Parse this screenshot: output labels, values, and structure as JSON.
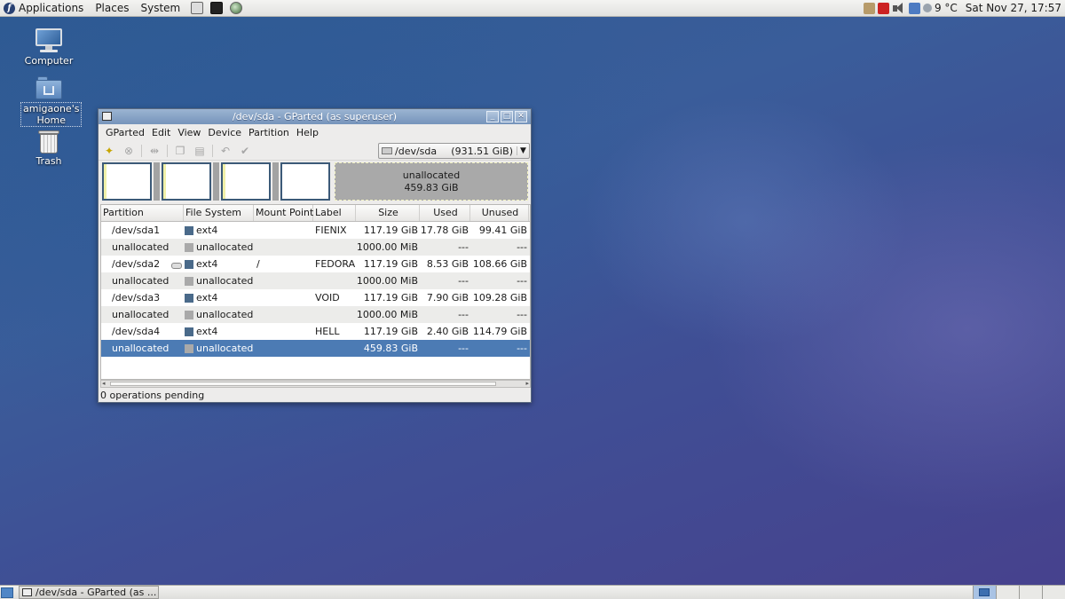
{
  "top_panel": {
    "menus": [
      "Applications",
      "Places",
      "System"
    ],
    "weather": "9 °C",
    "clock": "Sat Nov 27, 17:57"
  },
  "desktop": {
    "icons": [
      {
        "label": "Computer"
      },
      {
        "label": "amigaone's Home"
      },
      {
        "label": "Trash"
      }
    ]
  },
  "window": {
    "title": "/dev/sda - GParted (as superuser)",
    "menus": [
      "GParted",
      "Edit",
      "View",
      "Device",
      "Partition",
      "Help"
    ],
    "device_combo": {
      "device": "/dev/sda",
      "size": "(931.51 GiB)"
    },
    "disk_map": {
      "unallocated_label": "unallocated",
      "unallocated_size": "459.83 GiB"
    },
    "columns": [
      "Partition",
      "File System",
      "Mount Point",
      "Label",
      "Size",
      "Used",
      "Unused"
    ],
    "colors": {
      "ext4": "#4a6a8a",
      "unallocated": "#a9a9a9",
      "selection": "#4c7bb4"
    },
    "rows": [
      {
        "partition": "/dev/sda1",
        "fs": "ext4",
        "mount": "",
        "label": "FIENIX",
        "size": "117.19 GiB",
        "used": "17.78 GiB",
        "unused": "99.41 GiB"
      },
      {
        "partition": "unallocated",
        "fs": "unallocated",
        "mount": "",
        "label": "",
        "size": "1000.00 MiB",
        "used": "---",
        "unused": "---"
      },
      {
        "partition": "/dev/sda2",
        "fs": "ext4",
        "mount": "/",
        "label": "FEDORA",
        "size": "117.19 GiB",
        "used": "8.53 GiB",
        "unused": "108.66 GiB"
      },
      {
        "partition": "unallocated",
        "fs": "unallocated",
        "mount": "",
        "label": "",
        "size": "1000.00 MiB",
        "used": "---",
        "unused": "---"
      },
      {
        "partition": "/dev/sda3",
        "fs": "ext4",
        "mount": "",
        "label": "VOID",
        "size": "117.19 GiB",
        "used": "7.90 GiB",
        "unused": "109.28 GiB"
      },
      {
        "partition": "unallocated",
        "fs": "unallocated",
        "mount": "",
        "label": "",
        "size": "1000.00 MiB",
        "used": "---",
        "unused": "---"
      },
      {
        "partition": "/dev/sda4",
        "fs": "ext4",
        "mount": "",
        "label": "HELL",
        "size": "117.19 GiB",
        "used": "2.40 GiB",
        "unused": "114.79 GiB"
      },
      {
        "partition": "unallocated",
        "fs": "unallocated",
        "mount": "",
        "label": "",
        "size": "459.83 GiB",
        "used": "---",
        "unused": "---"
      }
    ],
    "status": "0 operations pending"
  },
  "bottom_panel": {
    "task_label": "/dev/sda - GParted (as ..."
  }
}
